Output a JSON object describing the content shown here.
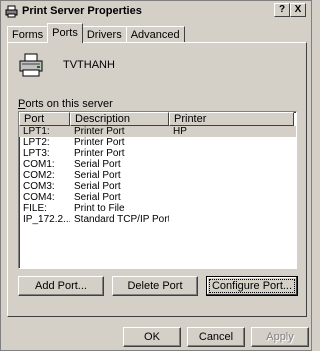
{
  "window": {
    "title": "Print Server Properties",
    "help_btn": "?",
    "close_btn": "X"
  },
  "tabs": [
    {
      "label": "Forms"
    },
    {
      "label": "Ports"
    },
    {
      "label": "Drivers"
    },
    {
      "label": "Advanced"
    }
  ],
  "active_tab": "Ports",
  "server": {
    "name": "TVTHANH",
    "icon": "printer-server-icon"
  },
  "ports_section": {
    "label": "Ports on this server",
    "columns": [
      "Port",
      "Description",
      "Printer"
    ],
    "rows": [
      {
        "port": "LPT1:",
        "description": "Printer Port",
        "printer": "HP",
        "selected": true
      },
      {
        "port": "LPT2:",
        "description": "Printer Port",
        "printer": ""
      },
      {
        "port": "LPT3:",
        "description": "Printer Port",
        "printer": ""
      },
      {
        "port": "COM1:",
        "description": "Serial Port",
        "printer": ""
      },
      {
        "port": "COM2:",
        "description": "Serial Port",
        "printer": ""
      },
      {
        "port": "COM3:",
        "description": "Serial Port",
        "printer": ""
      },
      {
        "port": "COM4:",
        "description": "Serial Port",
        "printer": ""
      },
      {
        "port": "FILE:",
        "description": "Print to File",
        "printer": ""
      },
      {
        "port": "IP_172.2...",
        "description": "Standard TCP/IP Port",
        "printer": ""
      }
    ]
  },
  "buttons": {
    "add_port": "Add Port...",
    "delete_port": "Delete Port",
    "configure_port": "Configure Port...",
    "ok": "OK",
    "cancel": "Cancel",
    "apply": "Apply"
  }
}
